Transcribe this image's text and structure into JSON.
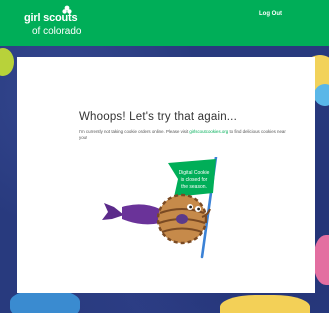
{
  "header": {
    "logo_line1": "girl scouts",
    "logo_line2": "of colorado",
    "logout_label": "Log Out"
  },
  "main": {
    "headline": "Whoops! Let's try that again...",
    "message_before_link": "I'm currently not taking cookie orders online. Please visit ",
    "message_link": "girlscoutcookies.org",
    "message_after_link": " to find delicious cookies near you!",
    "flag_text_line1": "Digital Cookie",
    "flag_text_line2": "is closed for",
    "flag_text_line3": "the season."
  },
  "colors": {
    "brand_green": "#00ae58",
    "background_blue": "#283a7e"
  }
}
